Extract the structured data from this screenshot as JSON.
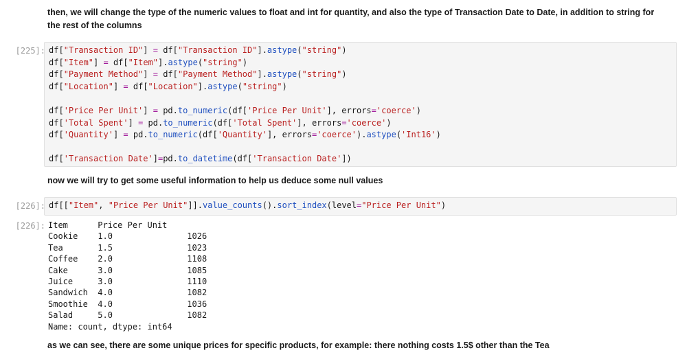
{
  "markdown": {
    "intro": "then, we will change the type of the numeric values to float and int for quantity, and also the type of Transaction Date to Date, in addition to string for the rest of the columns",
    "middle": "now we will try to get some useful information to help us deduce some null values",
    "conclusion": "as we can see, there are some unique prices for specific products, for example: there nothing costs 1.5$ other than the Tea"
  },
  "cells": {
    "cell_225": {
      "prompt": "[225]:",
      "lines": [
        "df[\"Transaction ID\"] = df[\"Transaction ID\"].astype(\"string\")",
        "df[\"Item\"] = df[\"Item\"].astype(\"string\")",
        "df[\"Payment Method\"] = df[\"Payment Method\"].astype(\"string\")",
        "df[\"Location\"] = df[\"Location\"].astype(\"string\")",
        "",
        "df['Price Per Unit'] = pd.to_numeric(df['Price Per Unit'], errors='coerce')",
        "df['Total Spent'] = pd.to_numeric(df['Total Spent'], errors='coerce')",
        "df['Quantity'] = pd.to_numeric(df['Quantity'], errors='coerce').astype('Int16')",
        "",
        "df['Transaction Date']=pd.to_datetime(df['Transaction Date'])"
      ]
    },
    "cell_226": {
      "prompt": "[226]:",
      "lines": [
        "df[[\"Item\", \"Price Per Unit\"]].value_counts().sort_index(level=\"Price Per Unit\")"
      ]
    },
    "output_226": {
      "prompt": "[226]:",
      "header": "Item      Price Per Unit",
      "rows": [
        "Cookie    1.0               1026",
        "Tea       1.5               1023",
        "Coffee    2.0               1108",
        "Cake      3.0               1085",
        "Juice     3.0               1110",
        "Sandwich  4.0               1082",
        "Smoothie  4.0               1036",
        "Salad     5.0               1082"
      ],
      "footer": "Name: count, dtype: int64"
    }
  }
}
